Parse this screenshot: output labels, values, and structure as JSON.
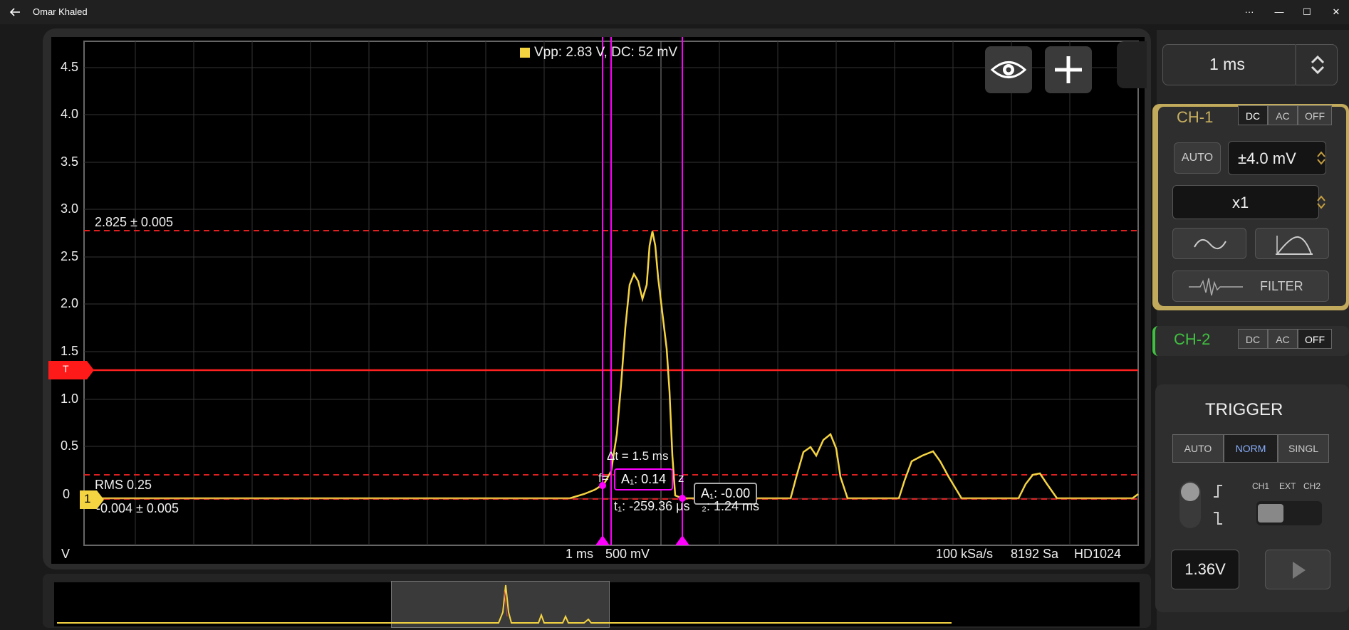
{
  "window": {
    "title": "Omar Khaled",
    "back_icon": "back-arrow-icon",
    "more": "···",
    "minimize": "—",
    "maximize": "☐",
    "close": "✕"
  },
  "scope": {
    "legend": "Vpp: 2.83 V, DC: 52 mV",
    "y_ticks": [
      "4.5",
      "4.0",
      "3.5",
      "3.0",
      "2.5",
      "2.0",
      "1.5",
      "1.0",
      "0.5",
      "0"
    ],
    "y_unit": "V",
    "upper_level_label": "2.825 ± 0.005",
    "rms_label": "RMS 0.25",
    "lower_level_label": "-0.004 ± 0.005",
    "trigger_marker": "T",
    "channel_marker": "1",
    "delta_t": "Δt = 1.5 ms",
    "freq_partial": "f=",
    "freq_suffix": "z",
    "cursor1_box": "A₁: 0.14",
    "cursor2_box": "A₁: -0.00",
    "t1_label": "t₁: -259.36 μs",
    "t2_label": "₂: 1.24 ms",
    "timebase": "1 ms",
    "voltdiv": "500 mV",
    "sample_rate": "100 kSa/s",
    "samples": "8192 Sa",
    "mode": "HD1024",
    "eye_icon": "eye-icon",
    "plus_icon": "plus-icon"
  },
  "colors": {
    "trace": "#f5d442",
    "cursor": "#ff00ff",
    "trigger": "#ff2020",
    "ch1": "#c8b060",
    "ch2": "#40c040"
  },
  "controls": {
    "timebase_value": "1 ms",
    "ch1": {
      "label": "CH-1",
      "coupling": [
        "DC",
        "AC",
        "OFF"
      ],
      "auto": "AUTO",
      "range": "±4.0 mV",
      "probe": "x1",
      "filter": "FILTER"
    },
    "ch2": {
      "label": "CH-2",
      "coupling": [
        "DC",
        "AC",
        "OFF"
      ]
    },
    "trigger": {
      "title": "TRIGGER",
      "modes": [
        "AUTO",
        "NORM",
        "SINGL"
      ],
      "sources": [
        "CH1",
        "EXT",
        "CH2"
      ],
      "level": "1.36V"
    }
  }
}
